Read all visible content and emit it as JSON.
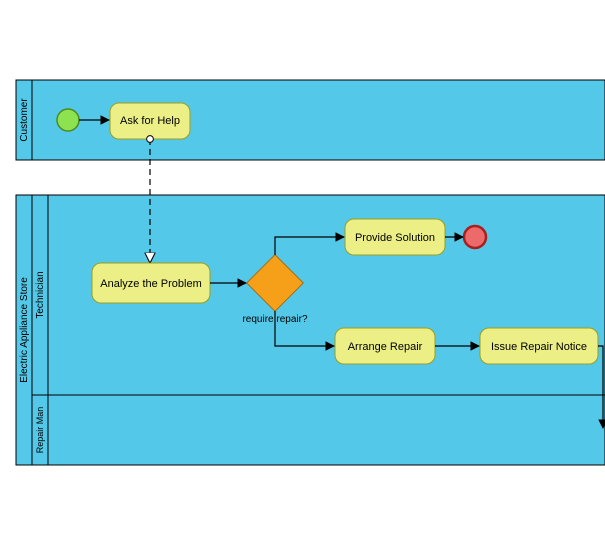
{
  "pool1": {
    "title": "Customer",
    "lanes": [
      {
        "title": ""
      }
    ]
  },
  "pool2": {
    "title": "Electric Appliance Store",
    "lanes": [
      {
        "title": "Technician"
      },
      {
        "title": "Repair Man"
      }
    ]
  },
  "tasks": {
    "ask_for_help": "Ask for Help",
    "analyze_problem": "Analyze the Problem",
    "provide_solution": "Provide Solution",
    "arrange_repair": "Arrange Repair",
    "issue_repair_notice": "Issue Repair Notice"
  },
  "gateway": {
    "label": "require repair?"
  },
  "colors": {
    "lane_fill": "#54c8e8",
    "task_fill": "#ecef86",
    "task_stroke": "#9b9e1f",
    "gateway_fill": "#f6a01a",
    "gateway_stroke": "#a66c10",
    "start_fill": "#8de24f",
    "start_stroke": "#4f8a1f",
    "end_fill": "#ec6a6a",
    "end_stroke": "#a91f1f",
    "border": "#000000"
  },
  "chart_data": {
    "type": "bpmn-diagram",
    "pools": [
      {
        "name": "Customer",
        "lanes": [
          {
            "name": "Customer",
            "elements": [
              {
                "id": "start1",
                "type": "startEvent"
              },
              {
                "id": "t1",
                "type": "task",
                "label": "Ask for Help"
              }
            ]
          }
        ]
      },
      {
        "name": "Electric Appliance Store",
        "lanes": [
          {
            "name": "Technician",
            "elements": [
              {
                "id": "t2",
                "type": "task",
                "label": "Analyze the Problem"
              },
              {
                "id": "g1",
                "type": "exclusiveGateway",
                "label": "require repair?"
              },
              {
                "id": "t3",
                "type": "task",
                "label": "Provide Solution"
              },
              {
                "id": "end1",
                "type": "endEvent"
              },
              {
                "id": "t4",
                "type": "task",
                "label": "Arrange Repair"
              },
              {
                "id": "t5",
                "type": "task",
                "label": "Issue Repair Notice"
              }
            ]
          },
          {
            "name": "Repair Man",
            "elements": []
          }
        ]
      }
    ],
    "sequenceFlows": [
      {
        "from": "start1",
        "to": "t1"
      },
      {
        "from": "t2",
        "to": "g1"
      },
      {
        "from": "g1",
        "to": "t3"
      },
      {
        "from": "t3",
        "to": "end1"
      },
      {
        "from": "g1",
        "to": "t4"
      },
      {
        "from": "t4",
        "to": "t5"
      },
      {
        "from": "t5",
        "to": "repair-man-lane"
      }
    ],
    "messageFlows": [
      {
        "from": "t1",
        "to": "t2"
      }
    ]
  }
}
